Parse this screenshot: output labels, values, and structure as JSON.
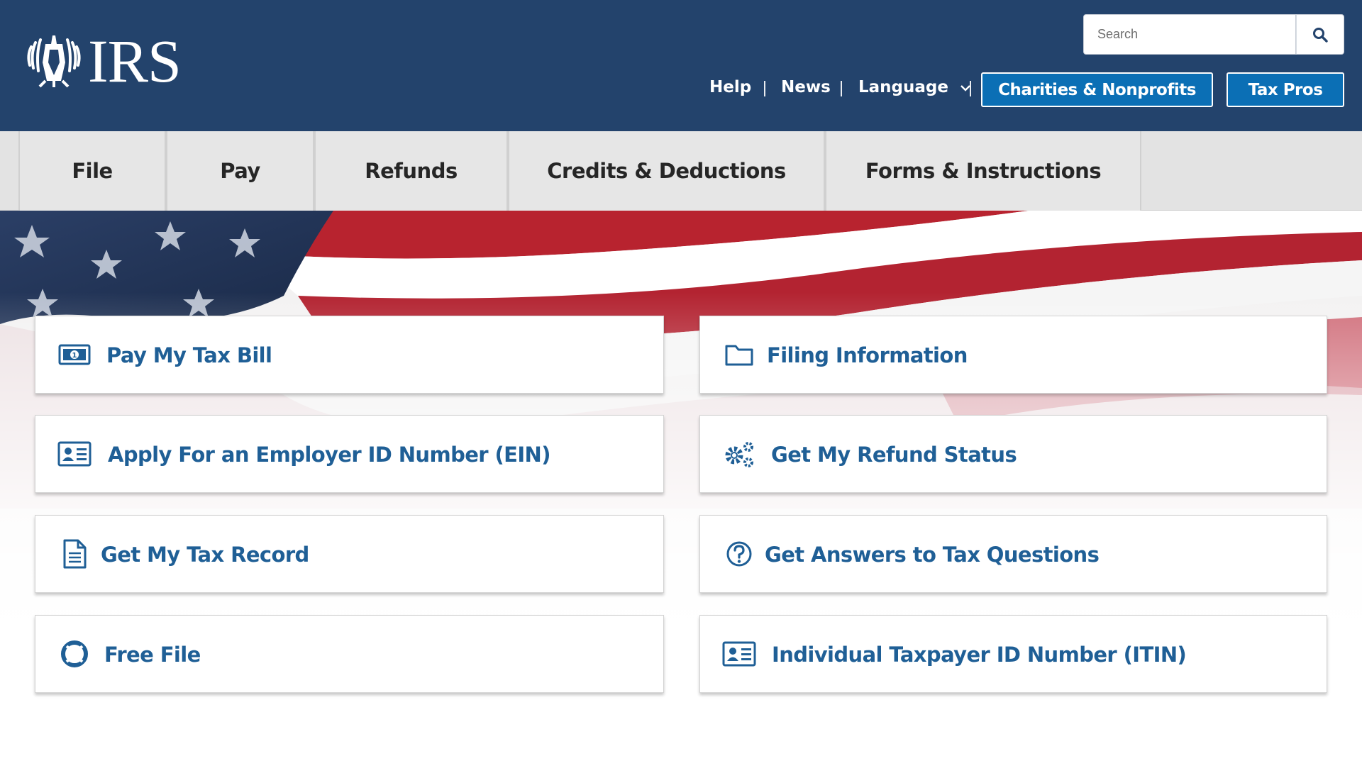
{
  "header": {
    "logo_text": "IRS",
    "search": {
      "placeholder": "Search"
    },
    "utility_links": [
      "Help",
      "News",
      "Language"
    ],
    "buttons": [
      "Charities & Nonprofits",
      "Tax Pros"
    ],
    "colors": {
      "background": "#23436c",
      "button_blue": "#0b6fb5"
    }
  },
  "main_nav": {
    "tabs": [
      "File",
      "Pay",
      "Refunds",
      "Credits & Deductions",
      "Forms & Instructions"
    ]
  },
  "cards": [
    {
      "label": "Pay My Tax Bill",
      "icon": "money-bill-icon"
    },
    {
      "label": "Filing Information",
      "icon": "folder-icon"
    },
    {
      "label": "Apply For an Employer ID Number (EIN)",
      "icon": "id-card-icon"
    },
    {
      "label": "Get My Refund Status",
      "icon": "gears-icon"
    },
    {
      "label": "Get My Tax Record",
      "icon": "document-icon"
    },
    {
      "label": "Get Answers to Tax Questions",
      "icon": "question-circle-icon"
    },
    {
      "label": "Free File",
      "icon": "life-ring-icon"
    },
    {
      "label": "Individual Taxpayer ID Number (ITIN)",
      "icon": "id-card-icon"
    }
  ],
  "colors": {
    "link_blue": "#1f5f96",
    "nav_gray": "#e6e6e6"
  }
}
